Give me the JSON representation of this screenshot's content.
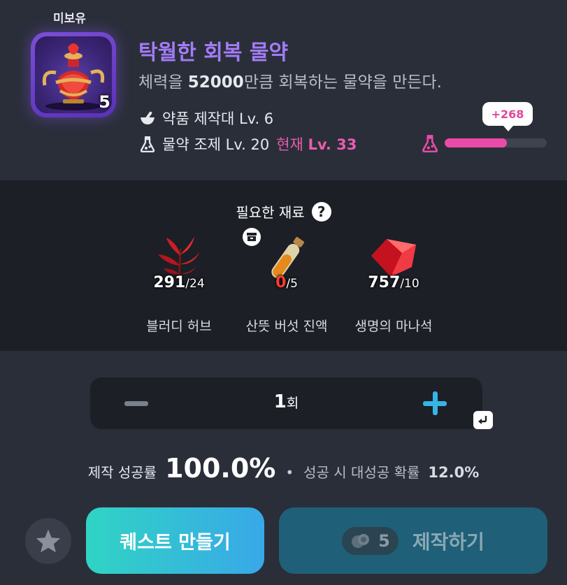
{
  "status": "미보유",
  "item": {
    "count": "5",
    "title": "탁월한 회복 물약",
    "desc_prefix": "체력을 ",
    "desc_value": "52000",
    "desc_suffix": "만큼 회복하는 물약을 만든다.",
    "icon_name": "red-potion-icon"
  },
  "requirements": {
    "station": {
      "label": "약품 제작대 Lv. 6",
      "icon": "mortar-icon"
    },
    "skill": {
      "label": "물약 조제 Lv. 20",
      "current_prefix": "현재",
      "current_value": "Lv. 33",
      "icon": "flask-icon"
    }
  },
  "experience": {
    "gain": "+268",
    "progress": 0.61,
    "color": "#ea4ba8",
    "icon": "flask-icon"
  },
  "materials": {
    "title": "필요한 재료",
    "help_icon": "question-icon",
    "storage_icon": "storage-box-icon",
    "items": [
      {
        "name": "블러디 허브",
        "have": "291",
        "need": "/24",
        "icon": "red-herb-icon"
      },
      {
        "name": "산뜻 버섯 진액",
        "have": "0",
        "need": "/5",
        "icon": "vial-icon"
      },
      {
        "name": "생명의 마나석",
        "have": "757",
        "need": "/10",
        "icon": "red-crystal-icon"
      }
    ]
  },
  "quantity": {
    "value": "1",
    "unit": "회",
    "minus_icon": "minus-icon",
    "plus_icon": "plus-icon",
    "enter_icon": "enter-icon"
  },
  "rates": {
    "success_label": "제작 성공률",
    "success_value": "100.0%",
    "great_label": "성공 시 대성공 확률",
    "great_value": "12.0%"
  },
  "buttons": {
    "favorite_icon": "star-icon",
    "quest": "퀘스트 만들기",
    "craft_cost": "5",
    "craft_cost_icon": "coin-icon",
    "craft": "제작하기"
  },
  "colors": {
    "accent_purple": "#a27cf6",
    "accent_pink": "#e85cb0",
    "quest_button": "#30d4c4",
    "craft_button": "#1f5f78"
  }
}
